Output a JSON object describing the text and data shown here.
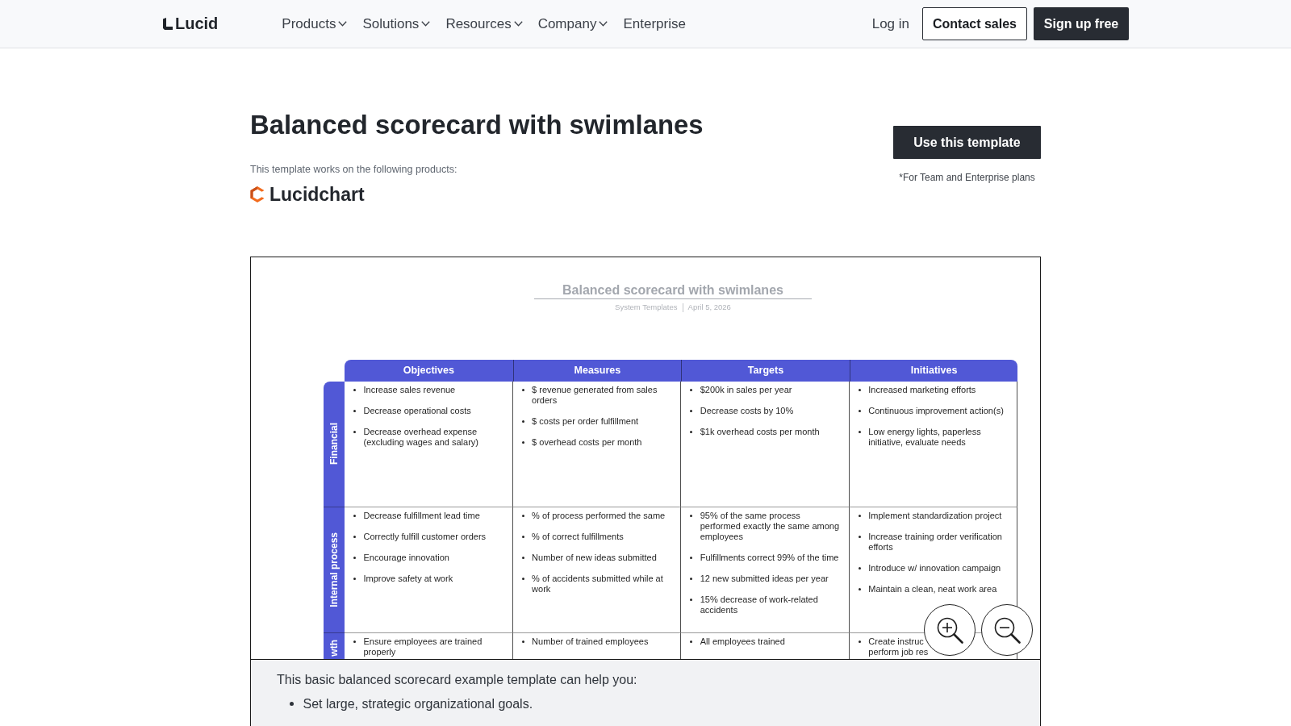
{
  "nav": {
    "logo": "Lucid",
    "menu": [
      {
        "label": "Products",
        "dropdown": true
      },
      {
        "label": "Solutions",
        "dropdown": true
      },
      {
        "label": "Resources",
        "dropdown": true
      },
      {
        "label": "Company",
        "dropdown": true
      },
      {
        "label": "Enterprise",
        "dropdown": false
      }
    ],
    "login": "Log in",
    "contact": "Contact sales",
    "signup": "Sign up free"
  },
  "template": {
    "title": "Balanced scorecard with swimlanes",
    "works_on": "This template works on the following products:",
    "product": "Lucidchart",
    "cta": "Use this template",
    "plans_note": "*For Team and Enterprise plans"
  },
  "preview": {
    "title": "Balanced scorecard with swimlanes",
    "source": "System Templates",
    "date": "April 5, 2026",
    "columns": [
      "Objectives",
      "Measures",
      "Targets",
      "Initiatives"
    ],
    "lanes": [
      {
        "label": "Financial",
        "cells": [
          [
            "Increase sales revenue",
            "Decrease operational costs",
            "Decrease overhead expense (excluding wages and salary)"
          ],
          [
            "$ revenue generated from sales orders",
            "$ costs per order fulfillment",
            "$ overhead costs per month"
          ],
          [
            "$200k in sales per year",
            "Decrease costs by 10%",
            "$1k overhead costs per month"
          ],
          [
            "Increased marketing efforts",
            "Continuous improvement action(s)",
            "Low energy lights, paperless initiative, evaluate needs"
          ]
        ]
      },
      {
        "label": "Internal process",
        "cells": [
          [
            "Decrease fulfillment lead time",
            "Correctly fulfill customer orders",
            "Encourage innovation",
            "Improve safety at work"
          ],
          [
            "% of process performed the same",
            "% of correct fulfillments",
            "Number of new ideas submitted",
            "% of accidents submitted while at work"
          ],
          [
            "95% of the same process performed exactly the same among employees",
            "Fulfillments correct 99% of the time",
            "12 new submitted ideas per year",
            "15% decrease of work-related accidents"
          ],
          [
            "Implement standardization project",
            "Increase training order verification efforts",
            "Introduce w/ innovation campaign",
            "Maintain a clean, neat work area"
          ]
        ]
      },
      {
        "label": "wth",
        "cells": [
          [
            "Ensure employees are trained properly"
          ],
          [
            "Number of trained employees"
          ],
          [
            "All employees trained"
          ],
          [
            "Create instruc\nperform job res"
          ]
        ]
      }
    ]
  },
  "description": {
    "intro": "This basic balanced scorecard example template can help you:",
    "points": [
      "Set large, strategic organizational goals."
    ]
  }
}
